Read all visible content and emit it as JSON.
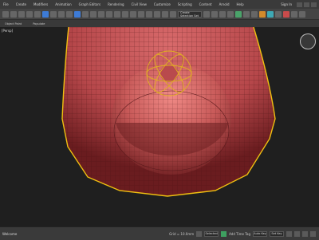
{
  "menubar": {
    "items": [
      "File",
      "Create",
      "Modifiers",
      "Animation",
      "Graph Editors",
      "Rendering",
      "Civil View",
      "Customize",
      "Scripting",
      "Content",
      "Arnold",
      "Help"
    ],
    "sign_in": "Sign In"
  },
  "toolbar": {
    "selection_set": "Create Selection Set"
  },
  "ribbon": {
    "items": [
      "Object Paint",
      "Populate"
    ]
  },
  "viewport": {
    "label": "[Persp]"
  },
  "status": {
    "left": "Welcome",
    "auto_key": "Auto Key",
    "set_key": "Set Key",
    "selected": "Selected",
    "time_tag": "Add Time Tag",
    "coords": "Grid = 10.0mm"
  },
  "colors": {
    "mesh": "#b6474a",
    "mesh_dark": "#5a1a1c",
    "selection": "#f0c010",
    "gizmo": "#e0b020"
  }
}
